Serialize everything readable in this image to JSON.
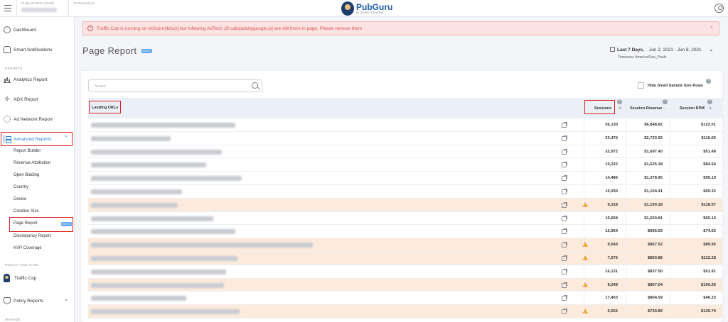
{
  "topbar": {
    "publishers_label": "PUBLISHERS (3696)",
    "domains_label": "DOMAINS(4)",
    "logo_name": "PubGuru",
    "logo_sub": "BY MONETIZEMORE"
  },
  "sidebar": {
    "items": [
      {
        "label": "Dashboard",
        "icon": "dashboard-icon"
      },
      {
        "label": "Smart Notifications",
        "icon": "bell-icon"
      },
      {
        "label": "Analytics Report",
        "icon": "bar-chart-icon"
      },
      {
        "label": "ADX Report",
        "icon": "adx-icon"
      },
      {
        "label": "Ad Network Report",
        "icon": "gear-icon"
      },
      {
        "label": "Advanced Reports",
        "icon": "tree-icon"
      },
      {
        "label": "Traffic Cop",
        "icon": "traffic-cop-icon"
      },
      {
        "label": "Policy Reports",
        "icon": "shield-icon"
      }
    ],
    "sections": {
      "reports": "REPORTS",
      "policy": "POLICY VIOLATION",
      "manage": "MANAGE"
    },
    "advanced_sub": [
      "Report Builder",
      "Revenue Attribution",
      "Open Bidding",
      "Country",
      "Device",
      "Creative Size",
      "Page Report",
      "Discrepancy Report",
      "KVP Coverage"
    ],
    "beta_label": "BETA"
  },
  "alert": {
    "text": "Traffic Cop is running on ivtAction[block] but following AdTech JS calls[adsbygoogle.js] are still there in page, Please remove them",
    "close": "×",
    "icon_glyph": "!"
  },
  "page": {
    "title": "Page Report",
    "beta": "BETA",
    "date_label": "Last 7 Days,",
    "date_range": "Jun 2, 2021 - Jun 8, 2021",
    "timezone": "Timezone: America/Sao_Paulo",
    "search_placeholder": "Search",
    "hide_small_label": "Hide Small Sample Size Rows"
  },
  "table": {
    "columns": [
      "Landing URLs",
      "Sessions",
      "Session Revenue",
      "Session RPM"
    ],
    "rows": [
      {
        "url_bar": 0.65,
        "warn": false,
        "sessions": "56,130",
        "revenue": "$6,848.82",
        "rpm": "$122.01"
      },
      {
        "url_bar": 0.36,
        "warn": false,
        "sessions": "23,470",
        "revenue": "$2,723.92",
        "rpm": "$116.05"
      },
      {
        "url_bar": 0.59,
        "warn": false,
        "sessions": "32,972",
        "revenue": "$1,697.40",
        "rpm": "$51.48"
      },
      {
        "url_bar": 0.52,
        "warn": false,
        "sessions": "19,222",
        "revenue": "$1,625.18",
        "rpm": "$84.54"
      },
      {
        "url_bar": 0.68,
        "warn": false,
        "sessions": "14,486",
        "revenue": "$1,378.95",
        "rpm": "$95.19"
      },
      {
        "url_bar": 0.41,
        "warn": false,
        "sessions": "15,930",
        "revenue": "$1,104.41",
        "rpm": "$69.32"
      },
      {
        "url_bar": 0.39,
        "warn": true,
        "sessions": "9,318",
        "revenue": "$1,100.18",
        "rpm": "$118.07"
      },
      {
        "url_bar": 0.55,
        "warn": false,
        "sessions": "15,668",
        "revenue": "$1,020.81",
        "rpm": "$65.15"
      },
      {
        "url_bar": 0.65,
        "warn": false,
        "sessions": "12,954",
        "revenue": "$966.69",
        "rpm": "$74.62"
      },
      {
        "url_bar": 1.0,
        "warn": true,
        "sessions": "9,644",
        "revenue": "$867.52",
        "rpm": "$89.95"
      },
      {
        "url_bar": 0.66,
        "warn": true,
        "sessions": "7,576",
        "revenue": "$850.88",
        "rpm": "$112.28"
      },
      {
        "url_bar": 0.61,
        "warn": false,
        "sessions": "16,131",
        "revenue": "$837.50",
        "rpm": "$51.91"
      },
      {
        "url_bar": 0.6,
        "warn": true,
        "sessions": "8,049",
        "revenue": "$807.04",
        "rpm": "$100.26"
      },
      {
        "url_bar": 0.43,
        "warn": false,
        "sessions": "17,403",
        "revenue": "$804.59",
        "rpm": "$46.23"
      },
      {
        "url_bar": 0.67,
        "warn": true,
        "sessions": "5,556",
        "revenue": "$720.89",
        "rpm": "$129.74"
      }
    ]
  }
}
